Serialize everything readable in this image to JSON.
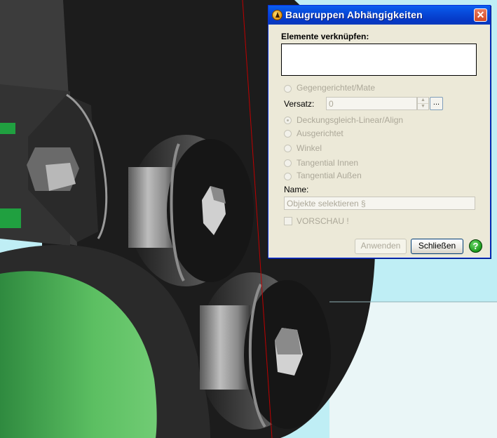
{
  "dialog": {
    "title": "Baugruppen Abhängigkeiten",
    "link_label": "Elemente verknüpfen:",
    "options": {
      "mate": "Gegengerichtet/Mate",
      "align": "Deckungsgleich-Linear/Align",
      "oriented": "Ausgerichtet",
      "angle": "Winkel",
      "tangent_inner": "Tangential Innen",
      "tangent_outer": "Tangential Außen"
    },
    "offset_label": "Versatz:",
    "offset_value": "0",
    "dots_label": "...",
    "name_label": "Name:",
    "name_placeholder": "Objekte selektieren §",
    "preview_label": "VORSCHAU !",
    "apply_label": "Anwenden",
    "close_label": "Schließen",
    "help_label": "?",
    "close_glyph": "✕"
  },
  "colors": {
    "sky": "#bfeef5",
    "part_dark": "#1c1c1c",
    "green_accent": "#20a040",
    "red_line": "#c00000"
  }
}
